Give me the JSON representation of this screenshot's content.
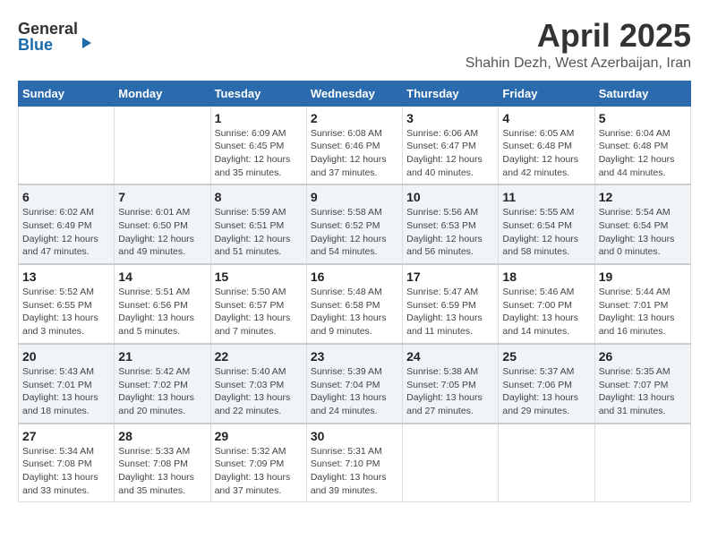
{
  "header": {
    "logo_general": "General",
    "logo_blue": "Blue",
    "month": "April 2025",
    "location": "Shahin Dezh, West Azerbaijan, Iran"
  },
  "days_of_week": [
    "Sunday",
    "Monday",
    "Tuesday",
    "Wednesday",
    "Thursday",
    "Friday",
    "Saturday"
  ],
  "weeks": [
    {
      "days": [
        {
          "num": "",
          "info": ""
        },
        {
          "num": "",
          "info": ""
        },
        {
          "num": "1",
          "info": "Sunrise: 6:09 AM\nSunset: 6:45 PM\nDaylight: 12 hours\nand 35 minutes."
        },
        {
          "num": "2",
          "info": "Sunrise: 6:08 AM\nSunset: 6:46 PM\nDaylight: 12 hours\nand 37 minutes."
        },
        {
          "num": "3",
          "info": "Sunrise: 6:06 AM\nSunset: 6:47 PM\nDaylight: 12 hours\nand 40 minutes."
        },
        {
          "num": "4",
          "info": "Sunrise: 6:05 AM\nSunset: 6:48 PM\nDaylight: 12 hours\nand 42 minutes."
        },
        {
          "num": "5",
          "info": "Sunrise: 6:04 AM\nSunset: 6:48 PM\nDaylight: 12 hours\nand 44 minutes."
        }
      ]
    },
    {
      "days": [
        {
          "num": "6",
          "info": "Sunrise: 6:02 AM\nSunset: 6:49 PM\nDaylight: 12 hours\nand 47 minutes."
        },
        {
          "num": "7",
          "info": "Sunrise: 6:01 AM\nSunset: 6:50 PM\nDaylight: 12 hours\nand 49 minutes."
        },
        {
          "num": "8",
          "info": "Sunrise: 5:59 AM\nSunset: 6:51 PM\nDaylight: 12 hours\nand 51 minutes."
        },
        {
          "num": "9",
          "info": "Sunrise: 5:58 AM\nSunset: 6:52 PM\nDaylight: 12 hours\nand 54 minutes."
        },
        {
          "num": "10",
          "info": "Sunrise: 5:56 AM\nSunset: 6:53 PM\nDaylight: 12 hours\nand 56 minutes."
        },
        {
          "num": "11",
          "info": "Sunrise: 5:55 AM\nSunset: 6:54 PM\nDaylight: 12 hours\nand 58 minutes."
        },
        {
          "num": "12",
          "info": "Sunrise: 5:54 AM\nSunset: 6:54 PM\nDaylight: 13 hours\nand 0 minutes."
        }
      ]
    },
    {
      "days": [
        {
          "num": "13",
          "info": "Sunrise: 5:52 AM\nSunset: 6:55 PM\nDaylight: 13 hours\nand 3 minutes."
        },
        {
          "num": "14",
          "info": "Sunrise: 5:51 AM\nSunset: 6:56 PM\nDaylight: 13 hours\nand 5 minutes."
        },
        {
          "num": "15",
          "info": "Sunrise: 5:50 AM\nSunset: 6:57 PM\nDaylight: 13 hours\nand 7 minutes."
        },
        {
          "num": "16",
          "info": "Sunrise: 5:48 AM\nSunset: 6:58 PM\nDaylight: 13 hours\nand 9 minutes."
        },
        {
          "num": "17",
          "info": "Sunrise: 5:47 AM\nSunset: 6:59 PM\nDaylight: 13 hours\nand 11 minutes."
        },
        {
          "num": "18",
          "info": "Sunrise: 5:46 AM\nSunset: 7:00 PM\nDaylight: 13 hours\nand 14 minutes."
        },
        {
          "num": "19",
          "info": "Sunrise: 5:44 AM\nSunset: 7:01 PM\nDaylight: 13 hours\nand 16 minutes."
        }
      ]
    },
    {
      "days": [
        {
          "num": "20",
          "info": "Sunrise: 5:43 AM\nSunset: 7:01 PM\nDaylight: 13 hours\nand 18 minutes."
        },
        {
          "num": "21",
          "info": "Sunrise: 5:42 AM\nSunset: 7:02 PM\nDaylight: 13 hours\nand 20 minutes."
        },
        {
          "num": "22",
          "info": "Sunrise: 5:40 AM\nSunset: 7:03 PM\nDaylight: 13 hours\nand 22 minutes."
        },
        {
          "num": "23",
          "info": "Sunrise: 5:39 AM\nSunset: 7:04 PM\nDaylight: 13 hours\nand 24 minutes."
        },
        {
          "num": "24",
          "info": "Sunrise: 5:38 AM\nSunset: 7:05 PM\nDaylight: 13 hours\nand 27 minutes."
        },
        {
          "num": "25",
          "info": "Sunrise: 5:37 AM\nSunset: 7:06 PM\nDaylight: 13 hours\nand 29 minutes."
        },
        {
          "num": "26",
          "info": "Sunrise: 5:35 AM\nSunset: 7:07 PM\nDaylight: 13 hours\nand 31 minutes."
        }
      ]
    },
    {
      "days": [
        {
          "num": "27",
          "info": "Sunrise: 5:34 AM\nSunset: 7:08 PM\nDaylight: 13 hours\nand 33 minutes."
        },
        {
          "num": "28",
          "info": "Sunrise: 5:33 AM\nSunset: 7:08 PM\nDaylight: 13 hours\nand 35 minutes."
        },
        {
          "num": "29",
          "info": "Sunrise: 5:32 AM\nSunset: 7:09 PM\nDaylight: 13 hours\nand 37 minutes."
        },
        {
          "num": "30",
          "info": "Sunrise: 5:31 AM\nSunset: 7:10 PM\nDaylight: 13 hours\nand 39 minutes."
        },
        {
          "num": "",
          "info": ""
        },
        {
          "num": "",
          "info": ""
        },
        {
          "num": "",
          "info": ""
        }
      ]
    }
  ]
}
